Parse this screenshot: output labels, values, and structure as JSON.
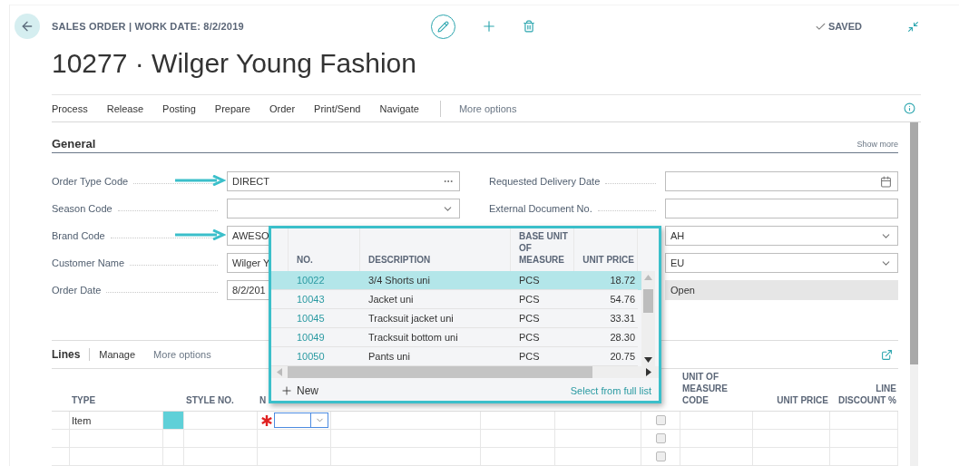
{
  "header": {
    "caption": "SALES ORDER | WORK DATE: 8/2/2019",
    "title": "10277 · Wilger Young Fashion",
    "status": "SAVED"
  },
  "actions": {
    "items": [
      "Process",
      "Release",
      "Posting",
      "Prepare",
      "Order",
      "Print/Send",
      "Navigate"
    ],
    "more": "More options"
  },
  "general": {
    "title": "General",
    "show_more": "Show more",
    "left": [
      {
        "label": "Order Type Code",
        "value": "DIRECT",
        "kind": "lookup",
        "callout": true
      },
      {
        "label": "Season Code",
        "kind": "select",
        "callout": false
      },
      {
        "label": "Brand Code",
        "value": "AWESO",
        "kind": "text",
        "callout": true
      },
      {
        "label": "Customer Name",
        "value": "Wilger Y",
        "kind": "text",
        "callout": false
      },
      {
        "label": "Order Date",
        "value": "8/2/201",
        "kind": "text",
        "callout": false
      }
    ],
    "right": [
      {
        "label": "Requested Delivery Date",
        "kind": "date"
      },
      {
        "label": "External Document No.",
        "kind": "text"
      },
      {
        "value": "AH",
        "kind": "select"
      },
      {
        "value": "EU",
        "kind": "select"
      },
      {
        "value": "Open",
        "kind": "readonly"
      }
    ]
  },
  "lines": {
    "title": "Lines",
    "actions": [
      "Manage",
      "More options"
    ],
    "columns": [
      {
        "kind": "handle"
      },
      {
        "kind": "type",
        "label": "TYPE"
      },
      {
        "kind": "marker"
      },
      {
        "kind": "style",
        "label": "STYLE NO."
      },
      {
        "kind": "no",
        "label": "N"
      },
      {
        "kind": "blank"
      },
      {
        "kind": "blank"
      },
      {
        "kind": "blank"
      },
      {
        "kind": "check"
      },
      {
        "kind": "uom",
        "label": "UNIT OF MEASURE CODE"
      },
      {
        "kind": "price",
        "label": "UNIT PRICE"
      },
      {
        "kind": "discount",
        "label": "LINE DISCOUNT %"
      }
    ],
    "rows": [
      {
        "selected": true,
        "type": "Item",
        "required": true,
        "checked": false
      },
      {
        "selected": false,
        "required": false,
        "checked": false
      },
      {
        "selected": false,
        "required": false,
        "checked": false
      }
    ]
  },
  "lookup": {
    "columns": [
      "NO.",
      "DESCRIPTION",
      "BASE UNIT OF MEASURE",
      "UNIT PRICE"
    ],
    "rows": [
      {
        "no": "10022",
        "description": "3/4 Shorts uni",
        "unit": "PCS",
        "price": "18.72",
        "selected": true
      },
      {
        "no": "10043",
        "description": "Jacket uni",
        "unit": "PCS",
        "price": "54.76",
        "selected": false
      },
      {
        "no": "10045",
        "description": "Tracksuit jacket uni",
        "unit": "PCS",
        "price": "33.31",
        "selected": false
      },
      {
        "no": "10049",
        "description": "Tracksuit bottom uni",
        "unit": "PCS",
        "price": "28.30",
        "selected": false
      },
      {
        "no": "10050",
        "description": "Pants uni",
        "unit": "PCS",
        "price": "20.75",
        "selected": false
      }
    ],
    "new": "New",
    "full_list": "Select from full list"
  }
}
